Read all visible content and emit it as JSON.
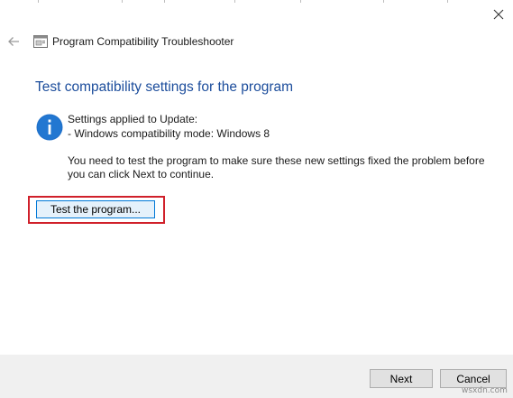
{
  "window": {
    "title": "Program Compatibility Troubleshooter",
    "close_icon": "close-icon",
    "back_icon": "back-arrow-icon",
    "app_icon": "troubleshooter-icon"
  },
  "main": {
    "heading": "Test compatibility settings for the program",
    "info_icon": "info-icon",
    "settings_label": "Settings applied to Update:",
    "setting_item": "- Windows compatibility mode: Windows 8",
    "instruction_line1": "You need to test the program to make sure these new settings fixed the problem before",
    "instruction_line2": "you can click Next to continue.",
    "test_button_label": "Test the program...",
    "highlight_color": "#d0202a",
    "heading_color": "#1c4d9c"
  },
  "footer": {
    "next_label": "Next",
    "cancel_label": "Cancel"
  },
  "watermark": "wsxdn.com"
}
